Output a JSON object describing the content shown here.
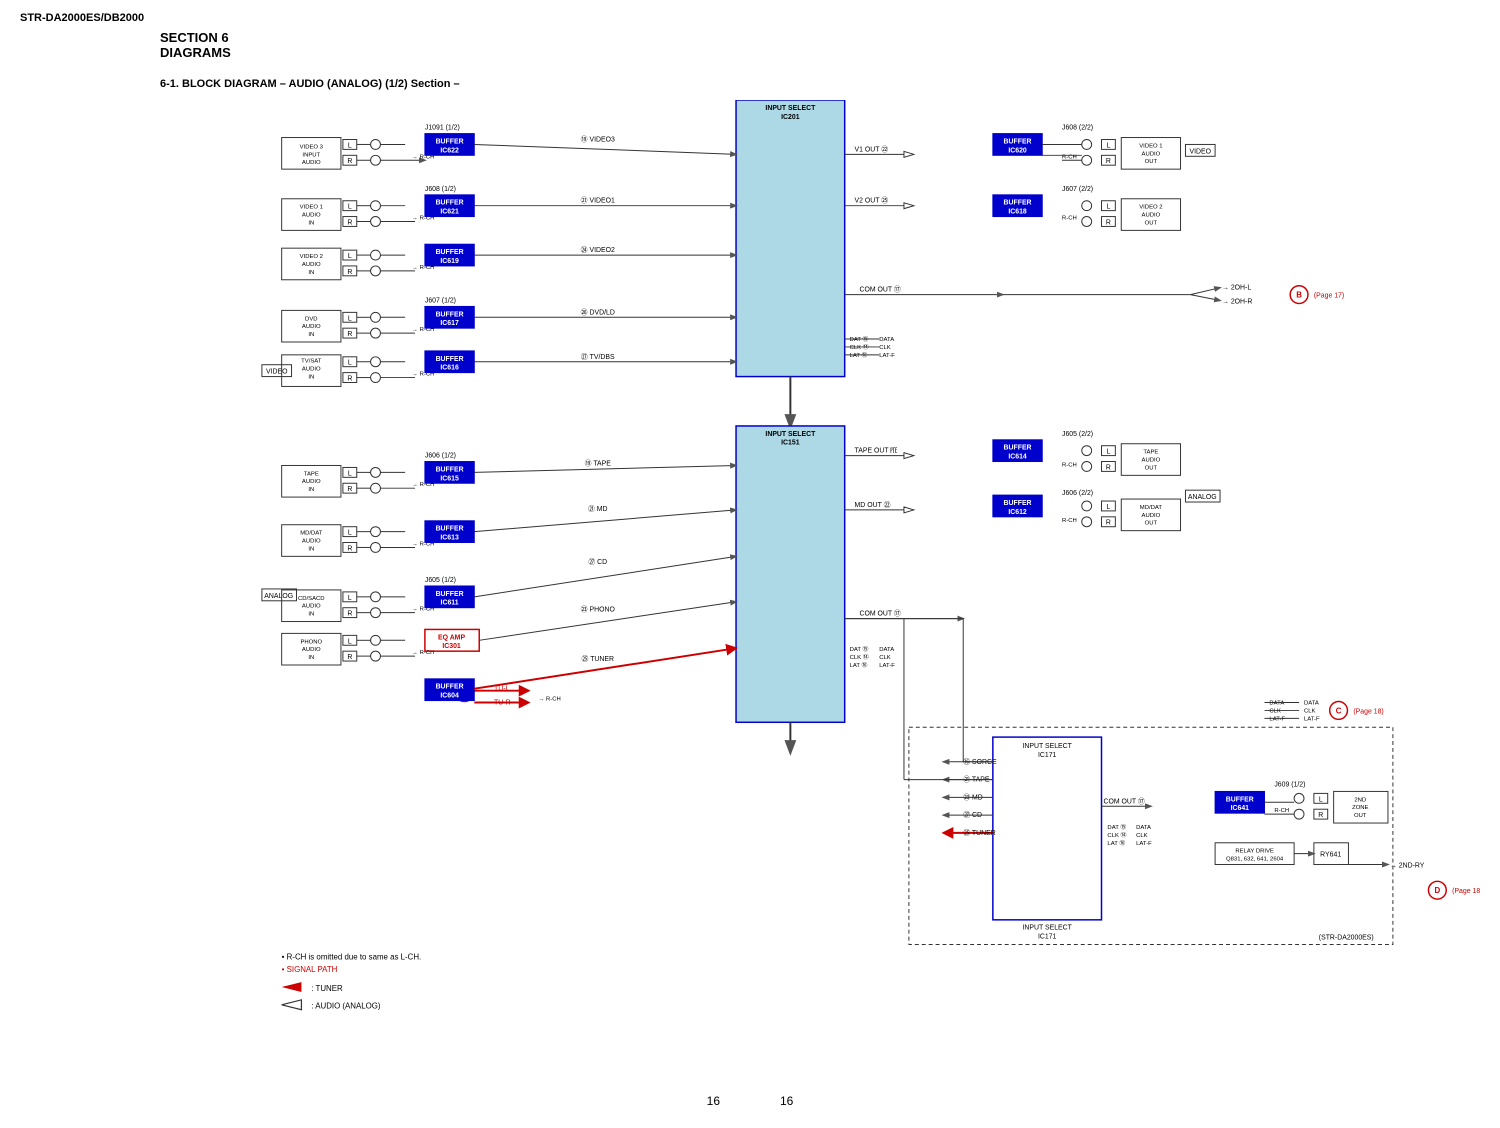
{
  "header": {
    "model": "STR-DA2000ES/DB2000"
  },
  "section": {
    "number": "SECTION  6",
    "title": "DIAGRAMS"
  },
  "diagram": {
    "title": "6-1.   BLOCK  DIAGRAM  – AUDIO (ANALOG) (1/2) Section –"
  },
  "page_numbers": [
    "16",
    "16"
  ],
  "legend": {
    "note1": "• R-CH is omitted due to same as L-CH.",
    "note2": "• SIGNAL PATH",
    "item1": ": TUNER",
    "item2": ": AUDIO (ANALOG)"
  }
}
